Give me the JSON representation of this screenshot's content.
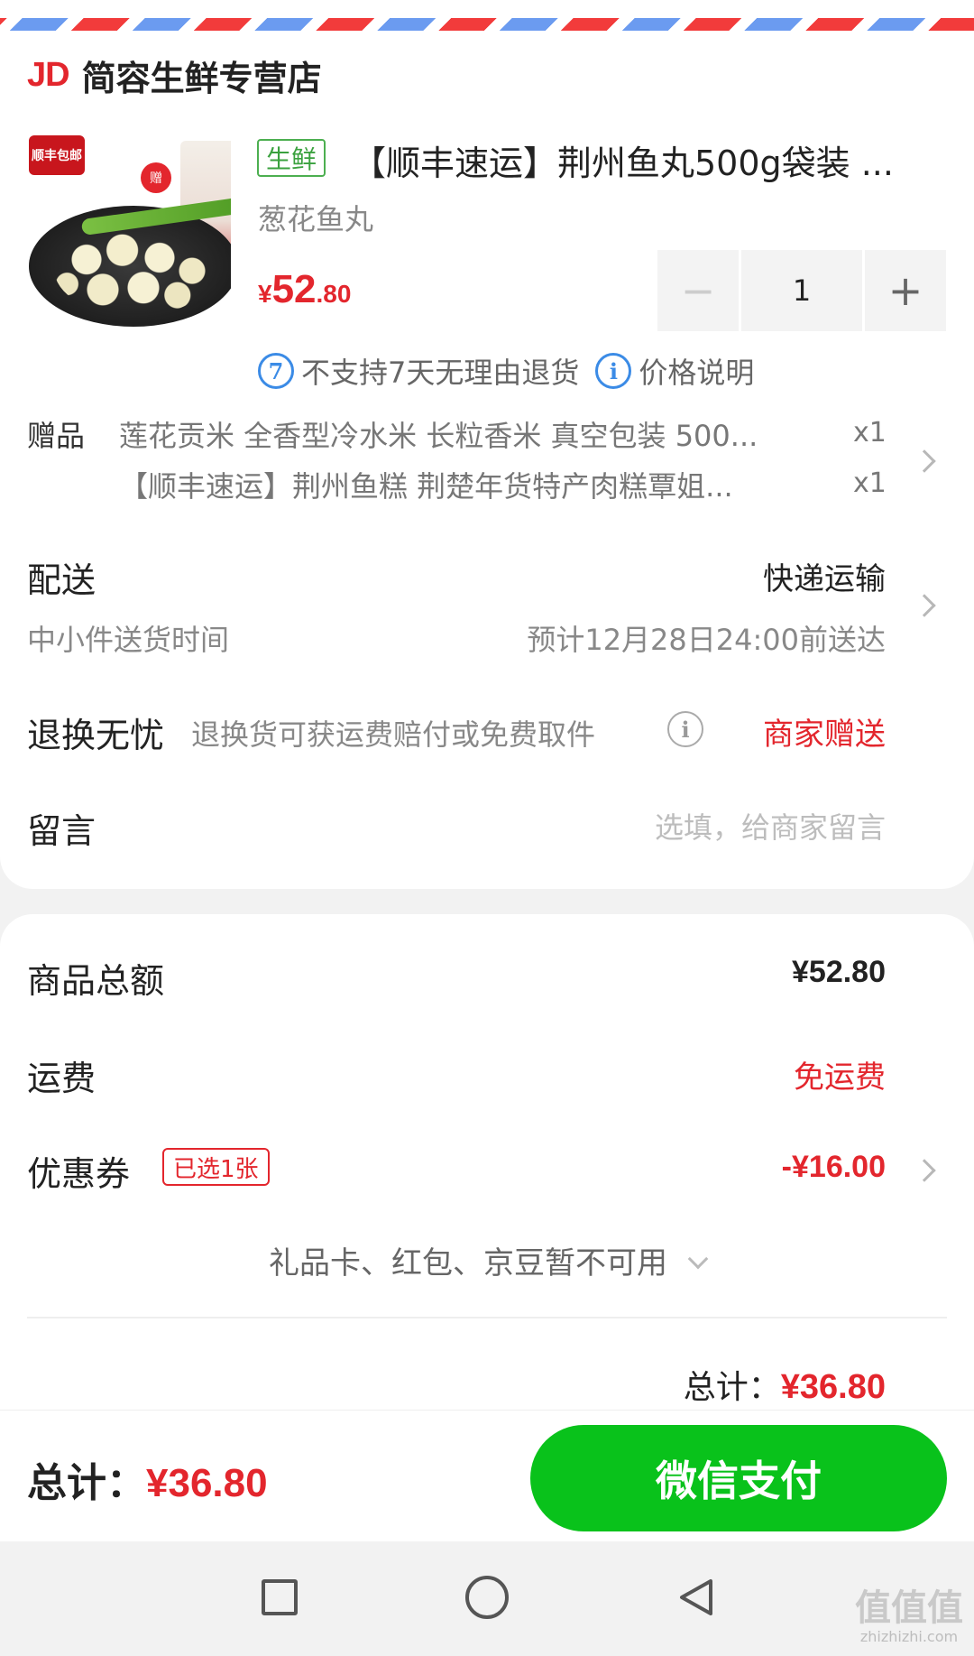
{
  "store": {
    "logo_text": "JD",
    "name": "简容生鲜专营店"
  },
  "product": {
    "image_badge": "顺丰包邮",
    "image_sticker": "赠",
    "tag": "生鲜",
    "title": "【顺丰速运】荆州鱼丸500g袋装 ...",
    "spec": "葱花鱼丸",
    "price_currency": "¥",
    "price_int": "52",
    "price_dec": ".80",
    "quantity": "1",
    "qty_minus": "−",
    "qty_plus": "+",
    "policy_no_return": "不支持7天无理由退货",
    "policy_price_note": "价格说明"
  },
  "gifts": {
    "label": "赠品",
    "items": [
      {
        "name": "莲花贡米 全香型冷水米 长粒香米 真空包装 500...",
        "qty": "x1"
      },
      {
        "name": "【顺丰速运】荆州鱼糕 荆楚年货特产肉糕覃姐...",
        "qty": "x1"
      }
    ]
  },
  "delivery": {
    "label": "配送",
    "method": "快递运输",
    "sub_label": "中小件送货时间",
    "eta": "预计12月28日24:00前送达"
  },
  "return_service": {
    "label": "退换无忧",
    "desc": "退换货可获运费赔付或免费取件",
    "status": "商家赠送"
  },
  "message": {
    "label": "留言",
    "placeholder": "选填，给商家留言"
  },
  "summary": {
    "goods_total_label": "商品总额",
    "goods_total": "¥52.80",
    "shipping_label": "运费",
    "shipping": "免运费",
    "coupon_label": "优惠券",
    "coupon_badge": "已选1张",
    "coupon_value": "-¥16.00",
    "unavailable_note": "礼品卡、红包、京豆暂不可用",
    "subtotal_label": "总计：",
    "subtotal": "¥36.80"
  },
  "bottom_bar": {
    "total_label": "总计：",
    "total": "¥36.80",
    "pay_button": "微信支付"
  },
  "watermark": {
    "main": "值值值",
    "sub": "zhizhizhi.com"
  },
  "colors": {
    "accent_red": "#e3262d",
    "pay_green": "#09c21b",
    "fresh_green": "#3aa13e",
    "info_blue": "#3b8be6"
  }
}
